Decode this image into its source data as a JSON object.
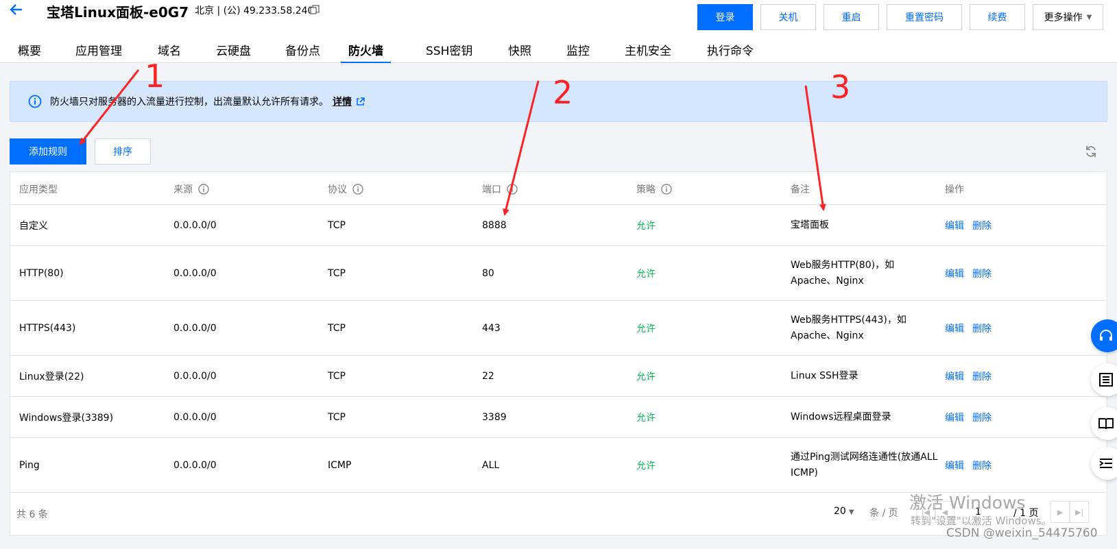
{
  "header": {
    "title": "宝塔Linux面板-e0G7",
    "subtitle": "北京 | (公) 49.233.58.240",
    "buttons": {
      "login": "登录",
      "shutdown": "关机",
      "restart": "重启",
      "reset_password": "重置密码",
      "renew": "续费",
      "more": "更多操作"
    }
  },
  "tabs": [
    "概要",
    "应用管理",
    "域名",
    "云硬盘",
    "备份点",
    "防火墙",
    "SSH密钥",
    "快照",
    "监控",
    "主机安全",
    "执行命令"
  ],
  "notice": {
    "text": "防火墙只对服务器的入流量进行控制，出流量默认允许所有请求。",
    "link": "详情"
  },
  "toolbar": {
    "add_rule": "添加规则",
    "sort": "排序"
  },
  "table": {
    "headers": [
      "应用类型",
      "来源",
      "协议",
      "端口",
      "策略",
      "备注",
      "操作"
    ],
    "rows": [
      {
        "type": "自定义",
        "source": "0.0.0.0/0",
        "protocol": "TCP",
        "port": "8888",
        "policy": "允许",
        "note": "宝塔面板"
      },
      {
        "type": "HTTP(80)",
        "source": "0.0.0.0/0",
        "protocol": "TCP",
        "port": "80",
        "policy": "允许",
        "note": "Web服务HTTP(80)，如Apache、Nginx"
      },
      {
        "type": "HTTPS(443)",
        "source": "0.0.0.0/0",
        "protocol": "TCP",
        "port": "443",
        "policy": "允许",
        "note": "Web服务HTTPS(443)，如Apache、Nginx"
      },
      {
        "type": "Linux登录(22)",
        "source": "0.0.0.0/0",
        "protocol": "TCP",
        "port": "22",
        "policy": "允许",
        "note": "Linux SSH登录"
      },
      {
        "type": "Windows登录(3389)",
        "source": "0.0.0.0/0",
        "protocol": "TCP",
        "port": "3389",
        "policy": "允许",
        "note": "Windows远程桌面登录"
      },
      {
        "type": "Ping",
        "source": "0.0.0.0/0",
        "protocol": "ICMP",
        "port": "ALL",
        "policy": "允许",
        "note": "通过Ping测试网络连通性(放通ALL ICMP)"
      }
    ],
    "actions": {
      "edit": "编辑",
      "delete": "删除"
    }
  },
  "pagination": {
    "total": "共 6 条",
    "page_size": "20",
    "unit": "条 / 页",
    "current_page": "1",
    "total_pages": "/ 1 页"
  },
  "overlay": {
    "windows_watermark_line1": "激活 Windows",
    "windows_watermark_line2": "转到\"设置\"以激活 Windows。",
    "csdn_watermark": "CSDN @weixin_54475760",
    "annotations": [
      "1",
      "2",
      "3"
    ]
  },
  "colors": {
    "primary": "#006eff",
    "allow": "#0abf5b",
    "annotation": "#ff2222",
    "notice_bg": "#d5e7ff"
  }
}
